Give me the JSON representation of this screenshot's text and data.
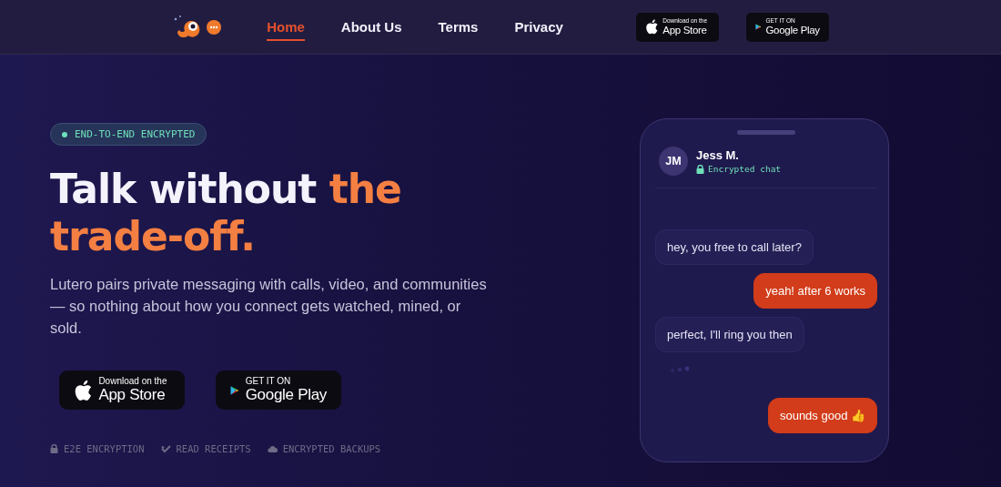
{
  "nav": {
    "links": [
      {
        "label": "Home",
        "selected": true
      },
      {
        "label": "About Us",
        "selected": false
      },
      {
        "label": "Terms",
        "selected": false
      },
      {
        "label": "Privacy",
        "selected": false
      }
    ],
    "stores": [
      {
        "kind": "apple",
        "small": "Download on the",
        "big": "App Store"
      },
      {
        "kind": "google",
        "small": "GET IT ON",
        "big": "Google Play"
      }
    ]
  },
  "hero": {
    "badge": "END-TO-END ENCRYPTED",
    "title_white": "Talk without",
    "title_accent": "the trade-off.",
    "lead": "Lutero pairs private messaging with calls, video, and communities — so nothing about how you connect gets watched, mined, or sold.",
    "stores": [
      {
        "kind": "apple",
        "small": "Download on the",
        "big": "App Store"
      },
      {
        "kind": "google",
        "small": "GET IT ON",
        "big": "Google Play"
      }
    ],
    "features": [
      {
        "kind": "lock",
        "label": "E2E ENCRYPTION"
      },
      {
        "kind": "check",
        "label": "READ RECEIPTS"
      },
      {
        "kind": "cloud",
        "label": "ENCRYPTED BACKUPS"
      }
    ]
  },
  "chat": {
    "initials": "JM",
    "name": "Jess M.",
    "status": "Encrypted chat",
    "messages": [
      {
        "kind": "in",
        "text": "hey, you free to call later?"
      },
      {
        "kind": "out",
        "text": "yeah! after 6 works"
      },
      {
        "kind": "in",
        "text": "perfect, I'll ring you then"
      },
      {
        "kind": "typing"
      },
      {
        "kind": "out",
        "text": "sounds good 👍"
      }
    ]
  }
}
